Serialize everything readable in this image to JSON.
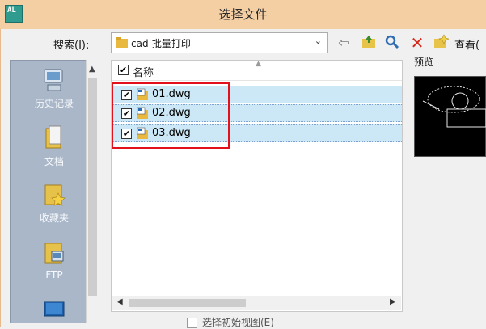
{
  "window": {
    "title": "选择文件",
    "app_icon_text": "AL",
    "accent": "#f5cfa4"
  },
  "search": {
    "label": "搜索(I):",
    "location": "cad-批量打印"
  },
  "toolbar": {
    "views_label": "查看("
  },
  "places": [
    {
      "label": "历史记录",
      "icon": "history-icon"
    },
    {
      "label": "文档",
      "icon": "documents-icon"
    },
    {
      "label": "收藏夹",
      "icon": "favorites-icon"
    },
    {
      "label": "FTP",
      "icon": "ftp-icon"
    },
    {
      "label": "",
      "icon": "desktop-icon"
    }
  ],
  "file_list": {
    "header": "名称",
    "header_checked": true,
    "files": [
      {
        "name": "01.dwg",
        "checked": true,
        "selected": true
      },
      {
        "name": "02.dwg",
        "checked": true,
        "selected": true
      },
      {
        "name": "03.dwg",
        "checked": true,
        "selected": true
      }
    ],
    "highlight_color": "#e3111b"
  },
  "preview": {
    "label": "预览"
  },
  "options": {
    "initial_view_label": "选择初始视图(E)",
    "initial_view_checked": false
  }
}
